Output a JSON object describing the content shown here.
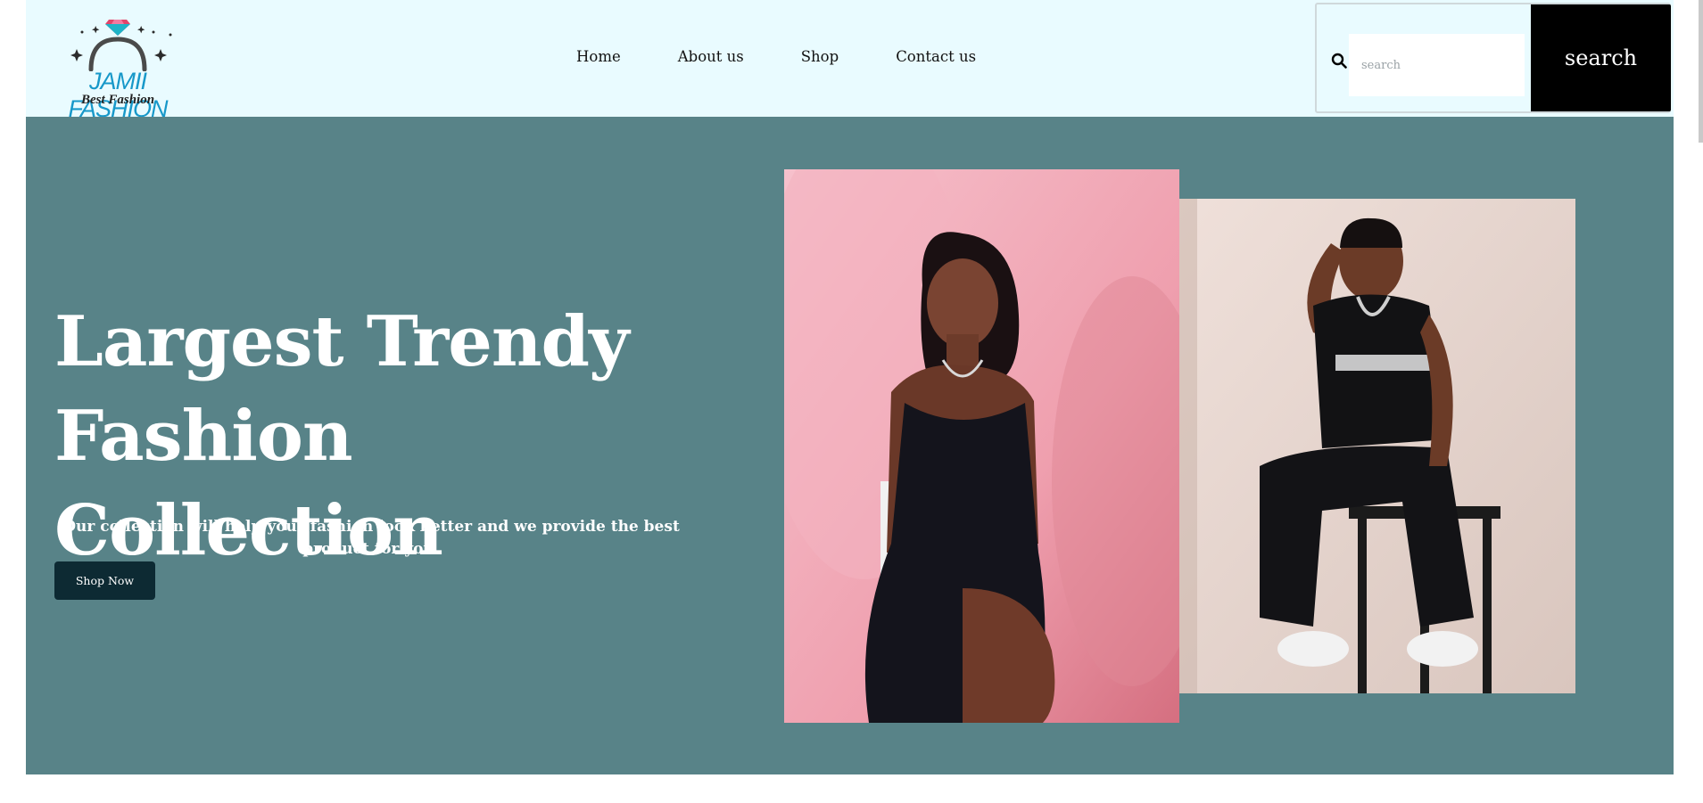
{
  "brand": {
    "name": "JAMII FASHION",
    "tagline": "Best Fashion",
    "accent_color": "#1798c9"
  },
  "nav": {
    "items": [
      {
        "label": "Home"
      },
      {
        "label": "About us"
      },
      {
        "label": "Shop"
      },
      {
        "label": "Contact us"
      }
    ]
  },
  "search": {
    "placeholder": "search",
    "value": "",
    "button_label": "search",
    "icon": "search-icon"
  },
  "hero": {
    "title_line1": "Largest Trendy",
    "title_line2": "Fashion Collection",
    "description": "Our collection will help your fashion look better and we provide the best product for you.",
    "cta_label": "Shop Now",
    "background_color": "#588388",
    "cta_color": "#0d2a33",
    "images": [
      {
        "name": "woman-in-black-dress-photo"
      },
      {
        "name": "man-in-black-outfit-photo"
      }
    ]
  }
}
